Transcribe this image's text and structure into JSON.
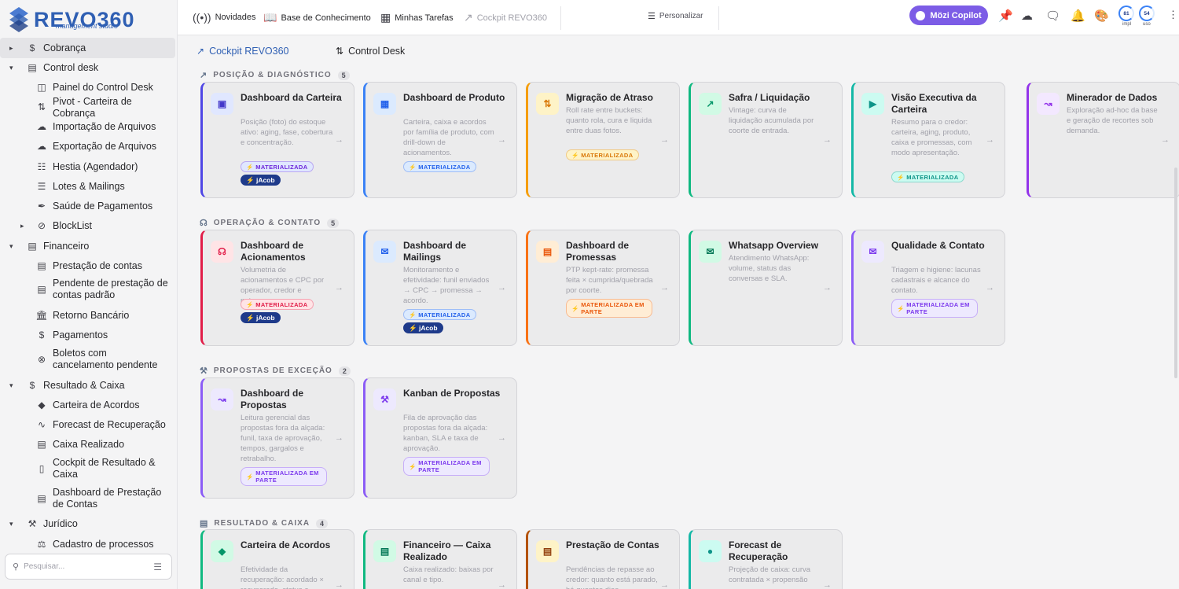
{
  "brand": {
    "name": "REVO360",
    "subtitle": "management studio",
    "color": "#2f5fb3"
  },
  "topbar": {
    "items": [
      {
        "icon": "broadcast-icon",
        "label": "Novidades"
      },
      {
        "icon": "book-icon",
        "label": "Base de Conhecimento"
      },
      {
        "icon": "tasks-board-icon",
        "label": "Minhas Tarefas"
      },
      {
        "icon": "chart-trend-icon",
        "label": "Cockpit REVO360"
      }
    ],
    "personalize": "Personalizar",
    "copilot": "Mözi Copilot",
    "gauges": [
      {
        "value": "81",
        "label": "impl"
      },
      {
        "value": "54",
        "label": "uso"
      }
    ]
  },
  "sidebar": {
    "items": [
      {
        "label": "Cobrança",
        "level": 0,
        "expand": "right",
        "icon": "money-icon"
      },
      {
        "label": "Control desk",
        "level": 0,
        "expand": "down",
        "icon": "desk-icon"
      },
      {
        "label": "Painel do Control Desk",
        "level": 1,
        "icon": "panel-icon"
      },
      {
        "label": "Pivot - Carteira de Cobrança",
        "level": 1,
        "icon": "pivot-icon"
      },
      {
        "label": "Importação de Arquivos",
        "level": 1,
        "icon": "cloud-upload-icon"
      },
      {
        "label": "Exportação de Arquivos",
        "level": 1,
        "icon": "cloud-download-icon"
      },
      {
        "label": "Hestia (Agendador)",
        "level": 1,
        "icon": "schedule-icon"
      },
      {
        "label": "Lotes & Mailings",
        "level": 1,
        "icon": "layers-icon"
      },
      {
        "label": "Saúde de Pagamentos",
        "level": 1,
        "icon": "health-icon"
      },
      {
        "label": "BlockList",
        "level": 1,
        "expand": "right",
        "icon": "block-icon"
      },
      {
        "label": "Financeiro",
        "level": 0,
        "expand": "down",
        "icon": "finance-icon"
      },
      {
        "label": "Prestação de contas",
        "level": 1,
        "icon": "document-icon"
      },
      {
        "label": "Pendente de prestação de contas padrão",
        "level": 1,
        "icon": "clipboard-clock-icon"
      },
      {
        "label": "Retorno Bancário",
        "level": 1,
        "icon": "bank-icon"
      },
      {
        "label": "Pagamentos",
        "level": 1,
        "icon": "dollar-icon"
      },
      {
        "label": "Boletos com cancelamento pendente",
        "level": 1,
        "icon": "cancel-circle-icon"
      },
      {
        "label": "Resultado & Caixa",
        "level": 0,
        "expand": "down",
        "icon": "coin-icon"
      },
      {
        "label": "Carteira de Acordos",
        "level": 1,
        "icon": "handshake-icon"
      },
      {
        "label": "Forecast de Recuperação",
        "level": 1,
        "icon": "forecast-icon"
      },
      {
        "label": "Caixa Realizado",
        "level": 1,
        "icon": "cash-icon"
      },
      {
        "label": "Cockpit de Resultado & Caixa",
        "level": 1,
        "icon": "bar-chart-icon"
      },
      {
        "label": "Dashboard de Prestação de Contas",
        "level": 1,
        "icon": "receipt-icon"
      },
      {
        "label": "Jurídico",
        "level": 0,
        "expand": "down",
        "icon": "gavel-icon"
      },
      {
        "label": "Cadastro de processos",
        "level": 1,
        "icon": "scale-icon"
      }
    ],
    "search_placeholder": "Pesquisar..."
  },
  "tabs": [
    {
      "label": "Cockpit REVO360",
      "active": true
    },
    {
      "label": "Control Desk",
      "active": false
    }
  ],
  "sections": [
    {
      "title": "POSIÇÃO & DIAGNÓSTICO",
      "count": "5",
      "icon": "trend-icon",
      "cards": [
        {
          "title": "Dashboard da Carteira",
          "desc": "Posição (foto) do estoque ativo: aging, fase, cobertura e concentração.",
          "accent": "#4f46e5",
          "icon_bg": "#e0e7ff",
          "icon_color": "#4338ca",
          "badges": [
            "MATERIALIZADA",
            "jAcob"
          ],
          "badge_color": "#6d28d9"
        },
        {
          "title": "Dashboard de Produto",
          "desc": "Carteira, caixa e acordos por família de produto, com drill-down de acionamentos.",
          "accent": "#3b82f6",
          "icon_bg": "#dbeafe",
          "icon_color": "#2563eb",
          "badges": [
            "MATERIALIZADA"
          ],
          "badge_color": "#2563eb"
        },
        {
          "title": "Migração de Atraso",
          "desc": "Roll rate entre buckets: quanto rola, cura e liquida entre duas fotos.",
          "accent": "#f59e0b",
          "icon_bg": "#fef3c7",
          "icon_color": "#d97706",
          "badges": [
            "MATERIALIZADA"
          ],
          "badge_color": "#d97706"
        },
        {
          "title": "Safra / Liquidação",
          "desc": "Vintage: curva de liquidação acumulada por coorte de entrada.",
          "accent": "#10b981",
          "icon_bg": "#d1fae5",
          "icon_color": "#059669",
          "badges": [],
          "badge_color": "#059669"
        },
        {
          "title": "Visão Executiva da Carteira",
          "desc": "Resumo para o credor: carteira, aging, produto, caixa e promessas, com modo apresentação.",
          "accent": "#14b8a6",
          "icon_bg": "#ccfbf1",
          "icon_color": "#0d9488",
          "badges": [
            "MATERIALIZADA"
          ],
          "badge_color": "#0d9488"
        },
        {
          "title": "Minerador de Dados",
          "desc": "Exploração ad-hoc da base e geração de recortes sob demanda.",
          "accent": "#9333ea",
          "icon_bg": "#f3e8ff",
          "icon_color": "#9333ea",
          "badges": [],
          "badge_color": "#9333ea"
        }
      ]
    },
    {
      "title": "OPERAÇÃO & CONTATO",
      "count": "5",
      "icon": "headset-icon",
      "cards": [
        {
          "title": "Dashboard de Acionamentos",
          "desc": "Volumetria de acionamentos e CPC por operador, credor e natureza.",
          "accent": "#e11d48",
          "icon_bg": "#ffe4e6",
          "icon_color": "#e11d48",
          "badges": [
            "MATERIALIZADA",
            "jAcob"
          ],
          "badge_color": "#e11d48"
        },
        {
          "title": "Dashboard de Mailings",
          "desc": "Monitoramento e efetividade: funil enviados → CPC → promessa → acordo.",
          "accent": "#3b82f6",
          "icon_bg": "#dbeafe",
          "icon_color": "#2563eb",
          "badges": [
            "MATERIALIZADA",
            "jAcob"
          ],
          "badge_color": "#2563eb"
        },
        {
          "title": "Dashboard de Promessas",
          "desc": "PTP kept-rate: promessa feita × cumprida/quebrada por coorte.",
          "accent": "#f97316",
          "icon_bg": "#ffedd5",
          "icon_color": "#ea580c",
          "badges": [
            "MATERIALIZADA EM PARTE"
          ],
          "badge_color": "#ea580c"
        },
        {
          "title": "Whatsapp Overview",
          "desc": "Atendimento WhatsApp: volume, status das conversas e SLA.",
          "accent": "#10b981",
          "icon_bg": "#d1fae5",
          "icon_color": "#047857",
          "badges": [],
          "badge_color": "#059669"
        },
        {
          "title": "Qualidade & Contato",
          "desc": "Triagem e higiene: lacunas cadastrais e alcance do contato.",
          "accent": "#8b5cf6",
          "icon_bg": "#ede9fe",
          "icon_color": "#7c3aed",
          "badges": [
            "MATERIALIZADA EM PARTE"
          ],
          "badge_color": "#7c3aed"
        }
      ]
    },
    {
      "title": "PROPOSTAS DE EXCEÇÃO",
      "count": "2",
      "icon": "gavel-small-icon",
      "cards": [
        {
          "title": "Dashboard de Propostas",
          "desc": "Leitura gerencial das propostas fora da alçada: funil, taxa de aprovação, tempos, gargalos e retrabalho.",
          "accent": "#8b5cf6",
          "icon_bg": "#ede9fe",
          "icon_color": "#7c3aed",
          "badges": [
            "MATERIALIZADA EM PARTE"
          ],
          "badge_color": "#7c3aed"
        },
        {
          "title": "Kanban de Propostas",
          "desc": "Fila de aprovação das propostas fora da alçada: kanban, SLA e taxa de aprovação.",
          "accent": "#8b5cf6",
          "icon_bg": "#ede9fe",
          "icon_color": "#7c3aed",
          "badges": [
            "MATERIALIZADA EM PARTE"
          ],
          "badge_color": "#7c3aed"
        }
      ]
    },
    {
      "title": "RESULTADO & CAIXA",
      "count": "4",
      "icon": "cash-small-icon",
      "cards": [
        {
          "title": "Carteira de Acordos",
          "desc": "Efetividade da recuperação: acordado × recuperado, status e",
          "accent": "#10b981",
          "icon_bg": "#d1fae5",
          "icon_color": "#059669",
          "badges": [],
          "badge_color": "#059669"
        },
        {
          "title": "Financeiro — Caixa Realizado",
          "desc": "Caixa realizado: baixas por canal e tipo.",
          "accent": "#10b981",
          "icon_bg": "#d1fae5",
          "icon_color": "#047857",
          "badges": [],
          "badge_color": "#059669"
        },
        {
          "title": "Prestação de Contas",
          "desc": "Pendências de repasse ao credor: quanto está parado, há quantos dias",
          "accent": "#b45309",
          "icon_bg": "#fef3c7",
          "icon_color": "#92400e",
          "badges": [],
          "badge_color": "#b45309"
        },
        {
          "title": "Forecast de Recuperação",
          "desc": "Projeção de caixa: curva contratada × propensão",
          "accent": "#14b8a6",
          "icon_bg": "#ccfbf1",
          "icon_color": "#0d9488",
          "badges": [],
          "badge_color": "#0d9488"
        }
      ]
    }
  ]
}
